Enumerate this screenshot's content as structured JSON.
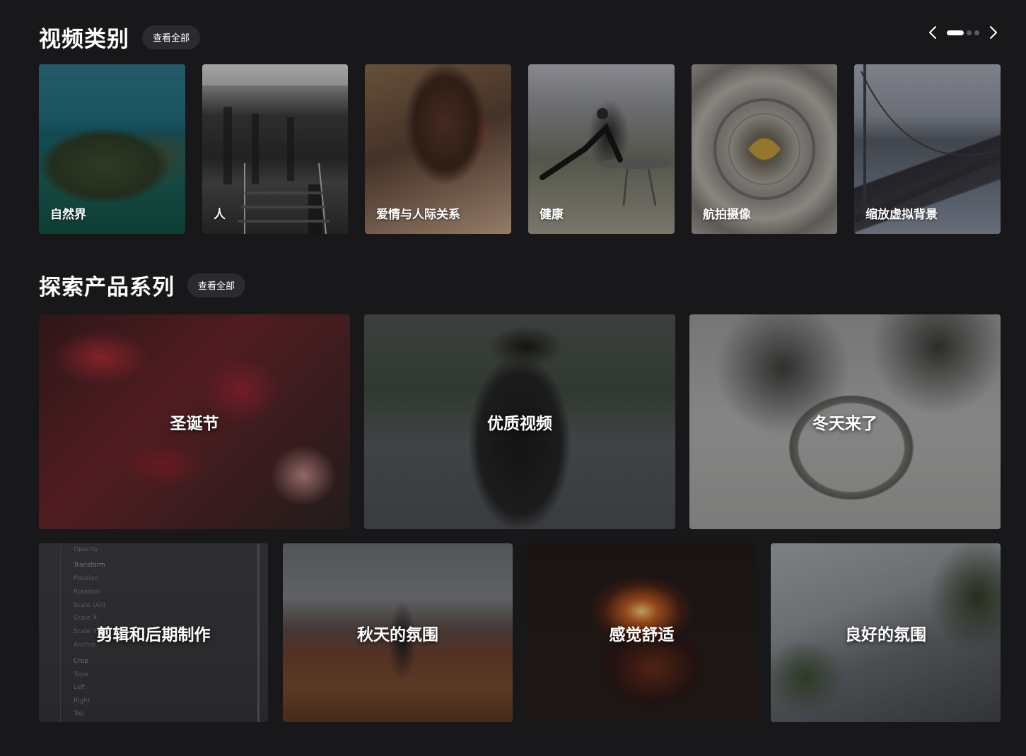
{
  "categories_section": {
    "title": "视频类别",
    "view_all": "查看全部",
    "items": [
      {
        "label": "自然界"
      },
      {
        "label": "人"
      },
      {
        "label": "爱情与人际关系"
      },
      {
        "label": "健康"
      },
      {
        "label": "航拍摄像"
      },
      {
        "label": "缩放虚拟背景"
      }
    ],
    "carousel": {
      "pages": 3,
      "active_page": 1
    }
  },
  "collections_section": {
    "title": "探索产品系列",
    "view_all": "查看全部",
    "row1": [
      {
        "label": "圣诞节"
      },
      {
        "label": "优质视频"
      },
      {
        "label": "冬天来了"
      }
    ],
    "row2": [
      {
        "label": "剪辑和后期制作"
      },
      {
        "label": "秋天的氛围"
      },
      {
        "label": "感觉舒适"
      },
      {
        "label": "良好的氛围"
      }
    ],
    "edit_panel_rows": [
      "Opacity",
      "Transform",
      "Position",
      "Rotation",
      "Scale (All)",
      "Scale X",
      "Scale Y",
      "Anchor",
      "Crop",
      "Type",
      "Left",
      "Right",
      "Top"
    ]
  },
  "icons": {
    "prev": "chevron-left-icon",
    "next": "chevron-right-icon"
  }
}
